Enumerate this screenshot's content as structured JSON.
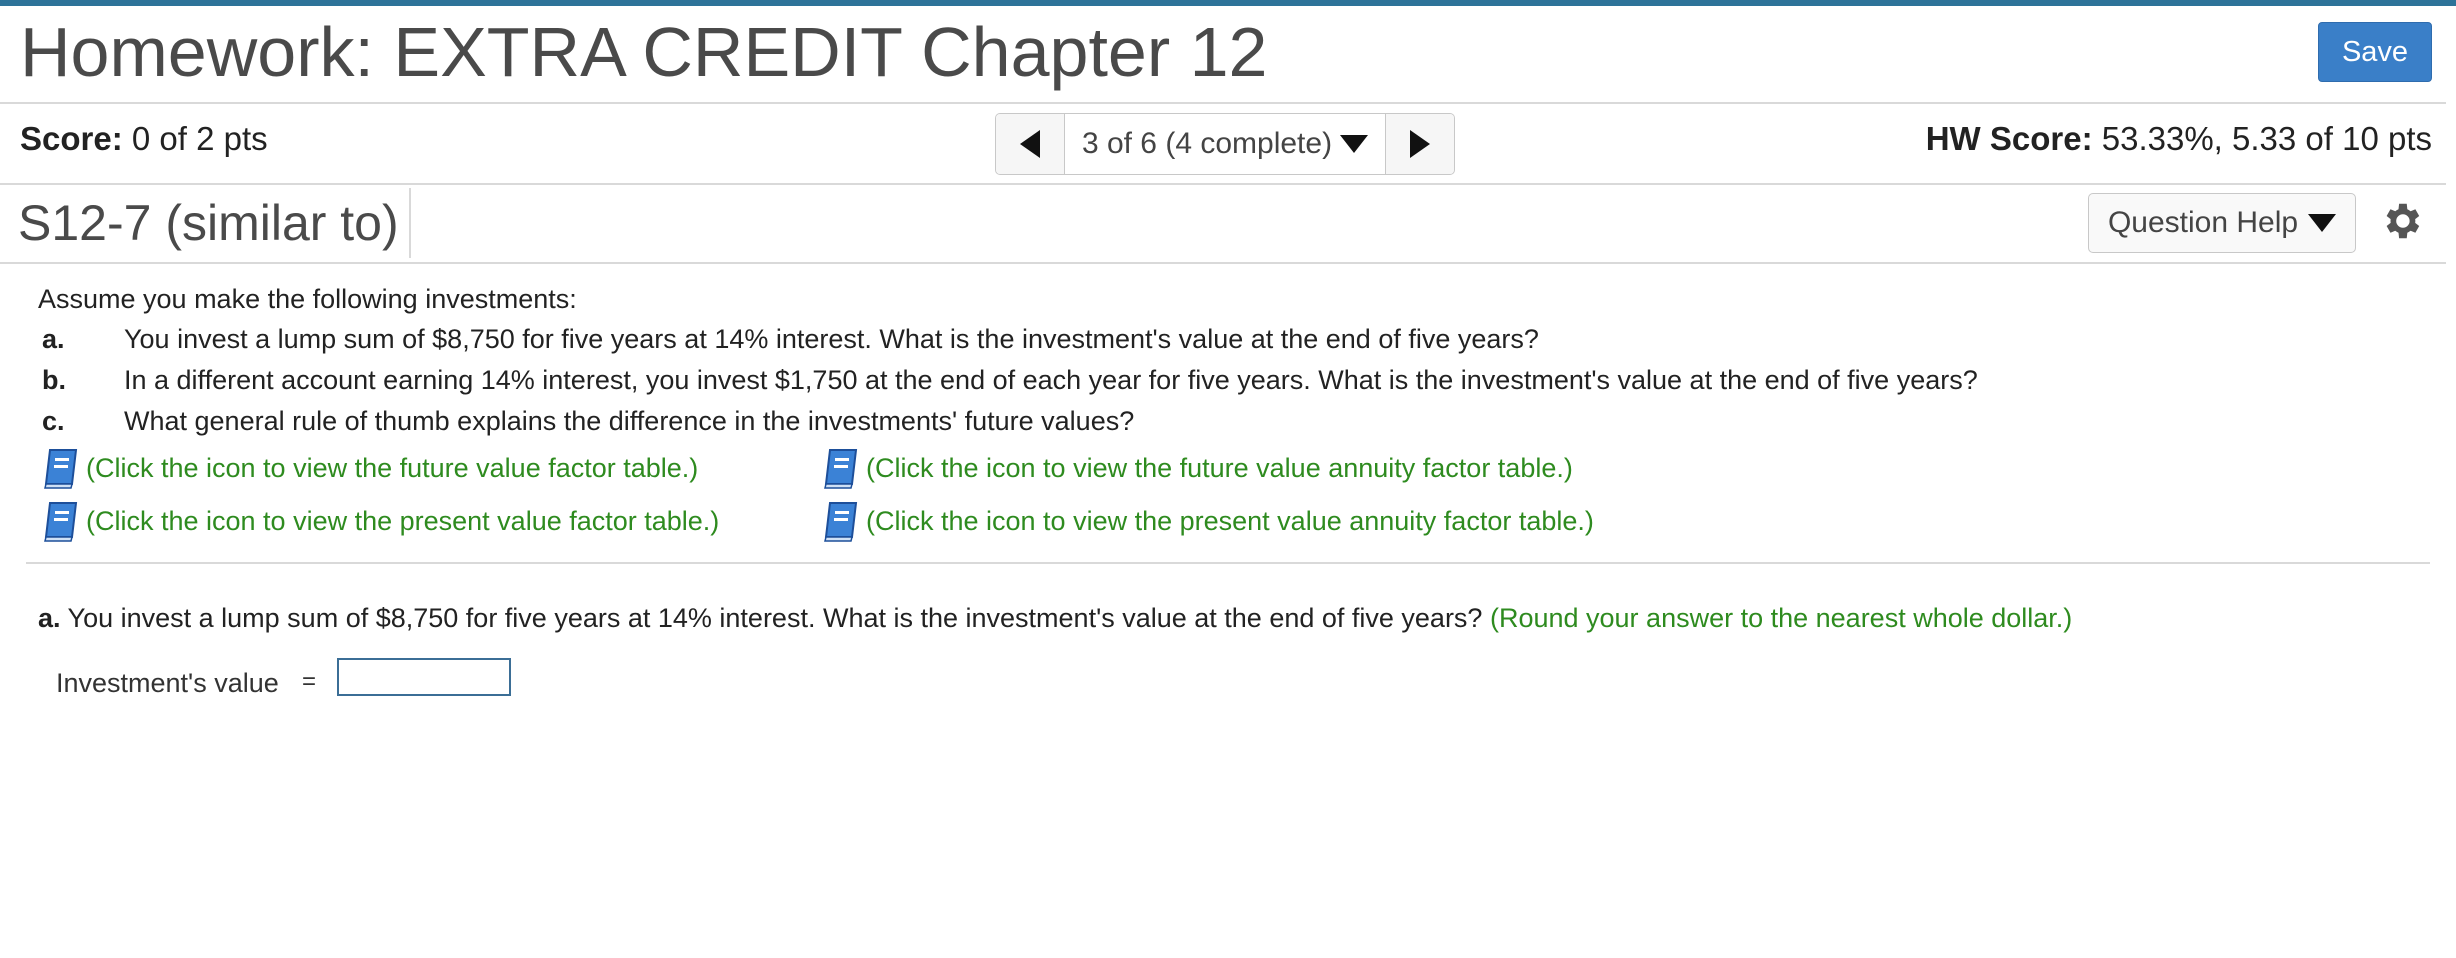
{
  "header": {
    "title": "Homework: EXTRA CREDIT Chapter 12",
    "save_label": "Save"
  },
  "status": {
    "score_label": "Score:",
    "score_value": "0 of 2 pts",
    "nav_text": "3 of 6 (4 complete)",
    "hw_score_label": "HW Score:",
    "hw_score_value": "53.33%, 5.33 of 10 pts"
  },
  "question_bar": {
    "question_id": "S12-7 (similar to)",
    "help_label": "Question Help"
  },
  "problem": {
    "intro": "Assume you make the following investments:",
    "items": [
      {
        "label": "a.",
        "text": "You invest a lump sum of $8,750 for five years at 14% interest. What is the investment's value at the end of five years?"
      },
      {
        "label": "b.",
        "text": "In a different account earning 14% interest, you invest $1,750 at the end of each year for five years. What is the investment's value at the end of five years?"
      },
      {
        "label": "c.",
        "text": "What general rule of thumb explains the difference in the investments' future values?"
      }
    ],
    "links": [
      "(Click the icon to view the future value factor table.)",
      "(Click the icon to view the future value annuity factor table.)",
      "(Click the icon to view the present value factor table.)",
      "(Click the icon to view the present value annuity factor table.)"
    ]
  },
  "part_a": {
    "label": "a.",
    "question": "You invest a lump sum of $8,750 for five years at 14% interest. What is the investment's value at the end of five years?",
    "hint": "(Round your answer to the nearest whole dollar.)",
    "field_label": "Investment's value",
    "equals": "=",
    "input_value": ""
  },
  "colors": {
    "accent": "#3a7fc8",
    "link_green": "#2e8b1f",
    "top_bar": "#2e7399"
  },
  "icons": [
    "triangle-left-icon",
    "triangle-right-icon",
    "chevron-down-icon",
    "gear-icon",
    "book-icon"
  ]
}
